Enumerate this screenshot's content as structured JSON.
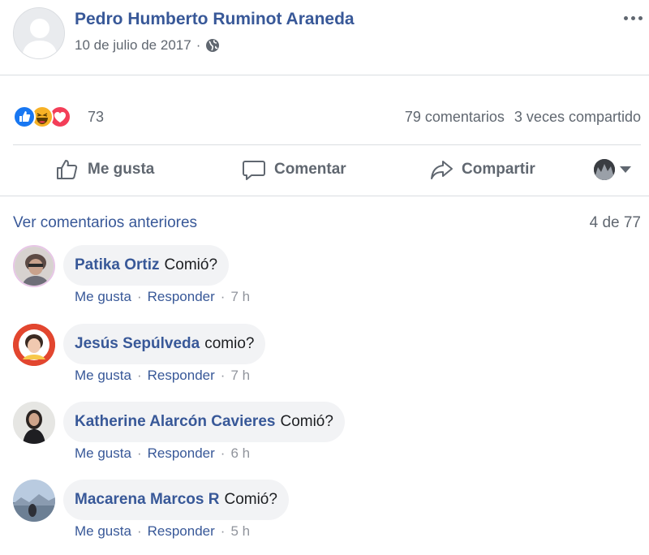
{
  "post": {
    "author": "Pedro Humberto Ruminot Araneda",
    "date": "10 de julio de 2017",
    "separator": "·",
    "privacy_icon": "globe-icon",
    "menu_icon": "more-options-icon"
  },
  "reactions": {
    "icons": [
      "like-icon",
      "haha-icon",
      "love-icon"
    ],
    "count": "73",
    "comments_label": "79 comentarios",
    "shares_label": "3 veces compartido"
  },
  "actions": {
    "like": "Me gusta",
    "comment": "Comentar",
    "share": "Compartir"
  },
  "comments_section": {
    "view_previous": "Ver comentarios anteriores",
    "counter": "4 de 77"
  },
  "comments": [
    {
      "name": "Patika Ortiz",
      "text": "Comió?",
      "like": "Me gusta",
      "reply": "Responder",
      "time": "7 h"
    },
    {
      "name": "Jesús Sepúlveda",
      "text": "comio?",
      "like": "Me gusta",
      "reply": "Responder",
      "time": "7 h"
    },
    {
      "name": "Katherine Alarcón Cavieres",
      "text": "Comió?",
      "like": "Me gusta",
      "reply": "Responder",
      "time": "6 h"
    },
    {
      "name": "Macarena Marcos R",
      "text": "Comió?",
      "like": "Me gusta",
      "reply": "Responder",
      "time": "5 h"
    }
  ],
  "colors": {
    "link": "#385898",
    "secondary": "#606770",
    "bubble": "#f2f3f5",
    "like": "#1877f2",
    "haha": "#f7b125",
    "love": "#f33e58"
  }
}
